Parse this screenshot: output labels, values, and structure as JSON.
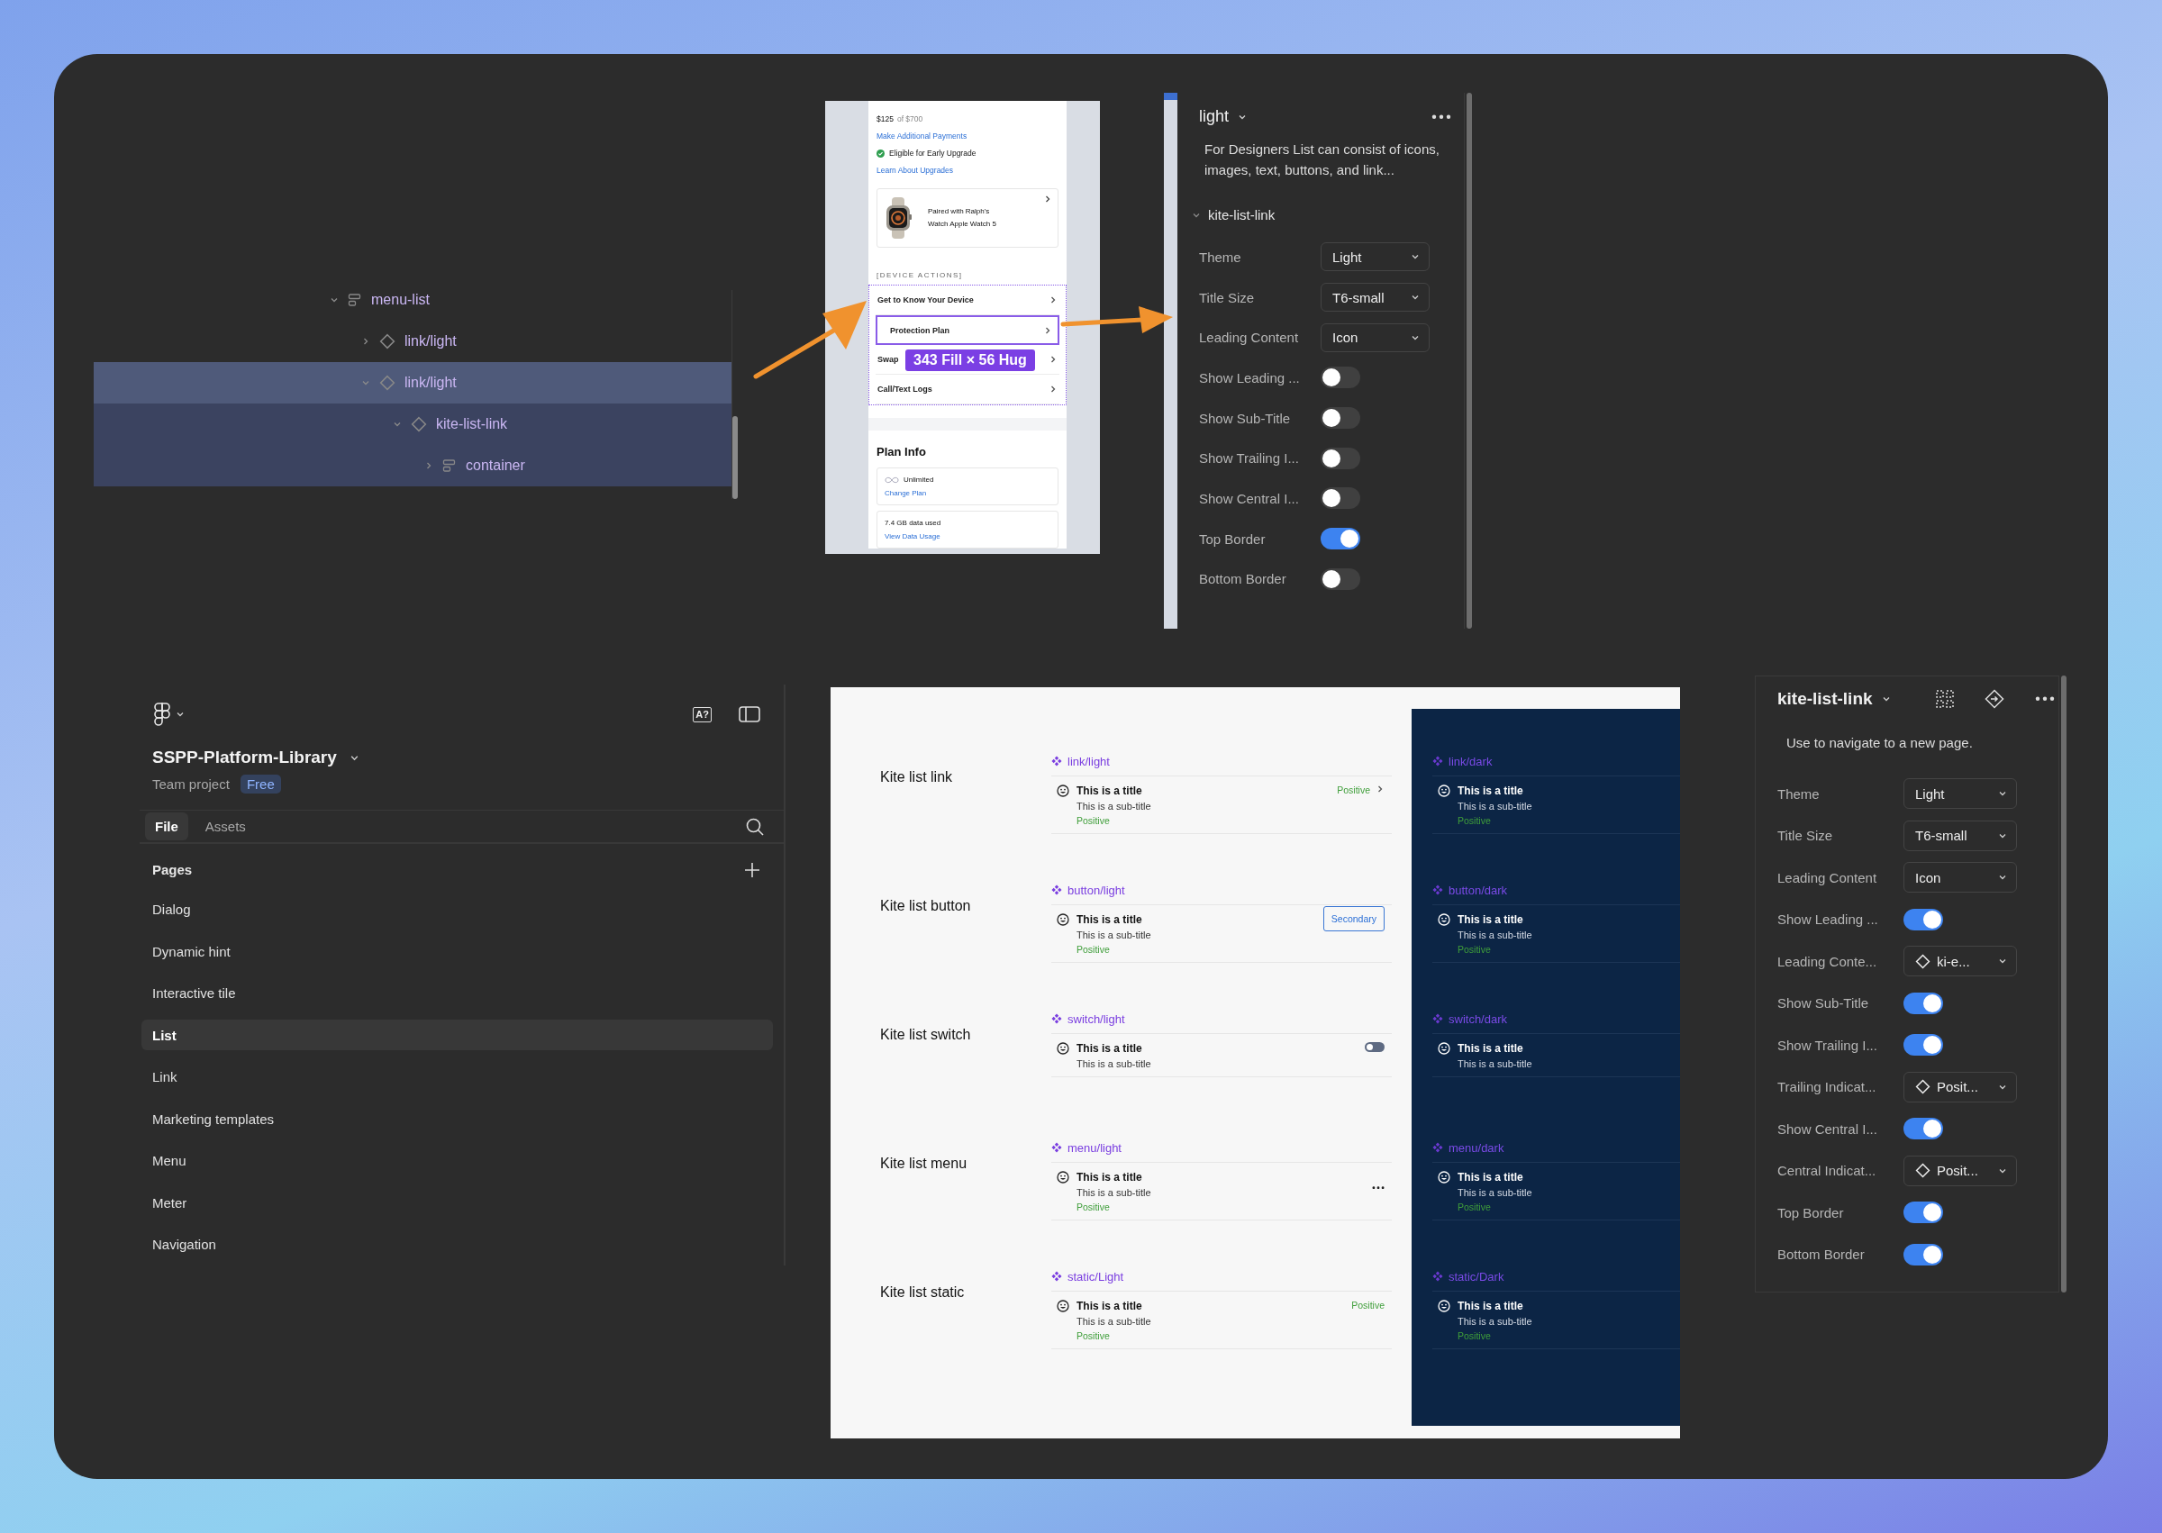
{
  "layers": [
    {
      "name": "menu-list",
      "kind": "frame",
      "expanded": true,
      "selected": false,
      "children": [
        {
          "name": "link/light",
          "kind": "instance",
          "expanded": false,
          "selected": false
        },
        {
          "name": "link/light",
          "kind": "instance",
          "expanded": true,
          "selected": true,
          "children": [
            {
              "name": "kite-list-link",
              "kind": "instance",
              "expanded": true,
              "selected": false,
              "children": [
                {
                  "name": "container",
                  "kind": "frame",
                  "expanded": false,
                  "selected": false
                }
              ]
            }
          ]
        }
      ]
    }
  ],
  "preview": {
    "amount": "$125",
    "amount_of": "of $700",
    "payment_link": "Make Additional Payments",
    "eligibility": "Eligible for Early Upgrade",
    "upgrade_link": "Learn About Upgrades",
    "device_card": {
      "lines": [
        "Paired with Ralph's",
        "Watch Apple Watch 5"
      ]
    },
    "section_title": "[DEVICE ACTIONS]",
    "actions": [
      {
        "label": "Get to Know Your Device",
        "selected": false
      },
      {
        "label": "Protection Plan",
        "selected": true
      },
      {
        "label": "Swap",
        "selected": false
      },
      {
        "label": "Call/Text Logs",
        "selected": false
      }
    ],
    "size_badge": "343 Fill × 56 Hug",
    "plan_title": "Plan Info",
    "plan_cards": [
      {
        "text": "Unlimited",
        "link": "Change Plan",
        "kind": "unlimited"
      },
      {
        "text": "7.4 GB data used",
        "link": "View Data Usage",
        "kind": "usage"
      }
    ]
  },
  "top_panel": {
    "title": "light",
    "description": "For Designers List can consist of icons, images, text, buttons, and link...",
    "section": "kite-list-link",
    "properties": [
      {
        "kind": "select",
        "label": "Theme",
        "value": "Light"
      },
      {
        "kind": "select",
        "label": "Title Size",
        "value": "T6-small"
      },
      {
        "kind": "select",
        "label": "Leading Content",
        "value": "Icon"
      },
      {
        "kind": "toggle",
        "label": "Show Leading ...",
        "on": false
      },
      {
        "kind": "toggle",
        "label": "Show Sub-Title",
        "on": false
      },
      {
        "kind": "toggle",
        "label": "Show Trailing I...",
        "on": false
      },
      {
        "kind": "toggle",
        "label": "Show Central I...",
        "on": false
      },
      {
        "kind": "toggle",
        "label": "Top Border",
        "on": true
      },
      {
        "kind": "toggle",
        "label": "Bottom Border",
        "on": false
      }
    ]
  },
  "sidebar": {
    "project": "SSPP-Platform-Library",
    "team": "Team project",
    "plan_badge": "Free",
    "font_button": "A?",
    "tabs": [
      {
        "label": "File",
        "selected": true
      },
      {
        "label": "Assets",
        "selected": false
      }
    ],
    "pages_title": "Pages",
    "pages": [
      {
        "label": "Dialog",
        "selected": false
      },
      {
        "label": "Dynamic hint",
        "selected": false
      },
      {
        "label": "Interactive tile",
        "selected": false
      },
      {
        "label": "List",
        "selected": true
      },
      {
        "label": "Link",
        "selected": false
      },
      {
        "label": "Marketing templates",
        "selected": false
      },
      {
        "label": "Menu",
        "selected": false
      },
      {
        "label": "Meter",
        "selected": false
      },
      {
        "label": "Navigation",
        "selected": false
      }
    ]
  },
  "canvas": {
    "sections": [
      {
        "label": "Kite list link",
        "light": {
          "name": "link/light",
          "title": "This is a title",
          "subtitle": "This is a sub-title",
          "status": "Positive",
          "trailing": {
            "kind": "link",
            "text": "Positive"
          }
        },
        "dark": {
          "name": "link/dark",
          "title": "This is a title",
          "subtitle": "This is a sub-title",
          "status": "Positive"
        }
      },
      {
        "label": "Kite list button",
        "light": {
          "name": "button/light",
          "title": "This is a title",
          "subtitle": "This is a sub-title",
          "status": "Positive",
          "trailing": {
            "kind": "button",
            "text": "Secondary"
          }
        },
        "dark": {
          "name": "button/dark",
          "title": "This is a title",
          "subtitle": "This is a sub-title",
          "status": "Positive"
        }
      },
      {
        "label": "Kite list switch",
        "light": {
          "name": "switch/light",
          "title": "This is a title",
          "subtitle": "This is a sub-title",
          "trailing": {
            "kind": "switch",
            "on": false
          }
        },
        "dark": {
          "name": "switch/dark",
          "title": "This is a title",
          "subtitle": "This is a sub-title"
        }
      },
      {
        "label": "Kite list menu",
        "light": {
          "name": "menu/light",
          "title": "This is a title",
          "subtitle": "This is a sub-title",
          "status": "Positive",
          "trailing": {
            "kind": "menu"
          }
        },
        "dark": {
          "name": "menu/dark",
          "title": "This is a title",
          "subtitle": "This is a sub-title",
          "status": "Positive"
        }
      },
      {
        "label": "Kite list static",
        "light": {
          "name": "static/Light",
          "title": "This is a title",
          "subtitle": "This is a sub-title",
          "status": "Positive",
          "trailing": {
            "kind": "static",
            "text": "Positive"
          }
        },
        "dark": {
          "name": "static/Dark",
          "title": "This is a title",
          "subtitle": "This is a sub-title",
          "status": "Positive"
        }
      }
    ]
  },
  "bottom_panel": {
    "title": "kite-list-link",
    "description": "Use to navigate to a new page.",
    "properties": [
      {
        "kind": "select",
        "label": "Theme",
        "value": "Light"
      },
      {
        "kind": "select",
        "label": "Title Size",
        "value": "T6-small"
      },
      {
        "kind": "select",
        "label": "Leading Content",
        "value": "Icon"
      },
      {
        "kind": "toggle",
        "label": "Show Leading ...",
        "on": true
      },
      {
        "kind": "instance",
        "label": "Leading Conte...",
        "value": "ki-e..."
      },
      {
        "kind": "toggle",
        "label": "Show Sub-Title",
        "on": true
      },
      {
        "kind": "toggle",
        "label": "Show Trailing I...",
        "on": true
      },
      {
        "kind": "instance",
        "label": "Trailing Indicat...",
        "value": "Posit..."
      },
      {
        "kind": "toggle",
        "label": "Show Central I...",
        "on": true
      },
      {
        "kind": "instance",
        "label": "Central Indicat...",
        "value": "Posit..."
      },
      {
        "kind": "toggle",
        "label": "Top Border",
        "on": true
      },
      {
        "kind": "toggle",
        "label": "Bottom Border",
        "on": true
      }
    ]
  }
}
